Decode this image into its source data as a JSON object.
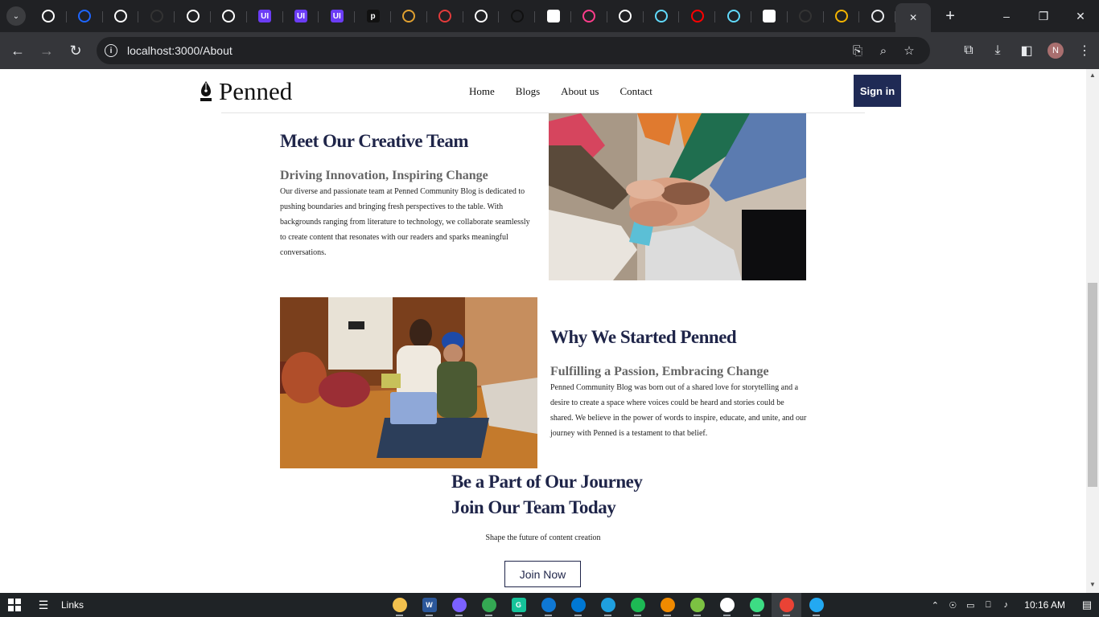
{
  "browser": {
    "tabs": [
      {
        "icon": "github-icon",
        "color": "#ffffff"
      },
      {
        "icon": "droplet-icon",
        "color": "#1e66ff"
      },
      {
        "icon": "github-icon",
        "color": "#ffffff"
      },
      {
        "icon": "blank-page-icon",
        "color": "#333333"
      },
      {
        "icon": "github-icon",
        "color": "#ffffff"
      },
      {
        "icon": "github-icon",
        "color": "#ffffff"
      },
      {
        "icon": "uiverse-icon",
        "color": "#6b3cf5",
        "text": "UI"
      },
      {
        "icon": "uiverse-icon",
        "color": "#6b3cf5",
        "text": "UI"
      },
      {
        "icon": "uiverse-icon",
        "color": "#6b3cf5",
        "text": "UI"
      },
      {
        "icon": "p-icon",
        "color": "#111111",
        "text": "p"
      },
      {
        "icon": "avatar-tab-icon",
        "color": "#e0a030"
      },
      {
        "icon": "tab-red-icon",
        "color": "#e33b3b"
      },
      {
        "icon": "openai-icon",
        "color": "#ffffff"
      },
      {
        "icon": "dark-tab-icon",
        "color": "#111111"
      },
      {
        "icon": "google-icon",
        "color": "#ffffff",
        "text": "G"
      },
      {
        "icon": "figma-colorful-icon",
        "color": "#ff3d8b"
      },
      {
        "icon": "github-icon",
        "color": "#ffffff"
      },
      {
        "icon": "react-icon",
        "color": "#61dafb"
      },
      {
        "icon": "youtube-icon",
        "color": "#ff0000"
      },
      {
        "icon": "react-icon",
        "color": "#61dafb"
      },
      {
        "icon": "google-icon",
        "color": "#ffffff",
        "text": "G"
      },
      {
        "icon": "blank-page-icon",
        "color": "#333333"
      },
      {
        "icon": "slides-icon",
        "color": "#f4b400"
      },
      {
        "icon": "download-icon",
        "color": "#e8eaed"
      }
    ],
    "url": "localhost:3000/About",
    "profile_initial": "N"
  },
  "site": {
    "brand": "Penned",
    "nav": [
      "Home",
      "Blogs",
      "About us",
      "Contact"
    ],
    "signin_label": "Sign in"
  },
  "team": {
    "title": "Meet Our Creative Team",
    "subtitle": "Driving Innovation, Inspiring Change",
    "body": "Our diverse and passionate team at Penned Community Blog is dedicated to pushing boundaries and bringing fresh perspectives to the table. With backgrounds ranging from literature to technology, we collaborate seamlessly to create content that resonates with our readers and sparks meaningful conversations."
  },
  "why": {
    "title": "Why We Started Penned",
    "subtitle": "Fulfilling a Passion, Embracing Change",
    "body": "Penned Community Blog was born out of a shared love for storytelling and a desire to create a space where voices could be heard and stories could be shared. We believe in the power of words to inspire, educate, and unite, and our journey with Penned is a testament to that belief."
  },
  "cta": {
    "title_line1": "Be a Part of Our Journey",
    "title_line2": "Join Our Team Today",
    "subtitle": "Shape the future of content creation",
    "button": "Join Now"
  },
  "taskbar": {
    "links_label": "Links",
    "apps": [
      {
        "icon": "file-explorer-icon",
        "color": "#f2c14e"
      },
      {
        "icon": "word-icon",
        "color": "#2b579a",
        "text": "W"
      },
      {
        "icon": "media-player-icon",
        "color": "#7b61ff"
      },
      {
        "icon": "chrome-icon",
        "color": "#34a853"
      },
      {
        "icon": "grammarly-icon",
        "color": "#15c39a",
        "text": "G"
      },
      {
        "icon": "mail-icon",
        "color": "#0f78d4"
      },
      {
        "icon": "store-icon",
        "color": "#0078d4"
      },
      {
        "icon": "edge-icon",
        "color": "#1fa0e0"
      },
      {
        "icon": "spotify-icon",
        "color": "#1db954"
      },
      {
        "icon": "vlc-icon",
        "color": "#f08a00"
      },
      {
        "icon": "bittorrent-icon",
        "color": "#7cc242"
      },
      {
        "icon": "github-desktop-icon",
        "color": "#ffffff"
      },
      {
        "icon": "android-studio-icon",
        "color": "#3ddc84"
      },
      {
        "icon": "chrome-icon",
        "color": "#ea4335"
      },
      {
        "icon": "vscode-icon",
        "color": "#23a9f2"
      }
    ],
    "clock": "10:16 AM"
  }
}
